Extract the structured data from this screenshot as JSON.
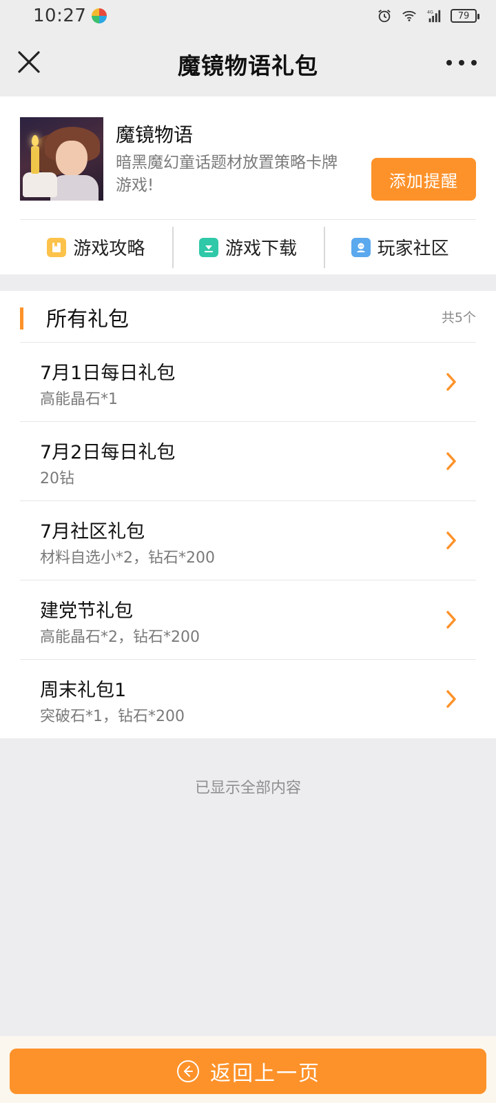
{
  "status_bar": {
    "time": "10:27",
    "battery": "79",
    "signal": "4G"
  },
  "header": {
    "title": "魔镜物语礼包"
  },
  "game": {
    "name": "魔镜物语",
    "description": "暗黑魔幻童话题材放置策略卡牌游戏!",
    "remind_button": "添加提醒",
    "links": [
      {
        "label": "游戏攻略",
        "icon": "guide-icon"
      },
      {
        "label": "游戏下载",
        "icon": "download-icon"
      },
      {
        "label": "玩家社区",
        "icon": "community-icon"
      }
    ]
  },
  "gift_section": {
    "title": "所有礼包",
    "count": "共5个",
    "items": [
      {
        "name": "7月1日每日礼包",
        "reward": "高能晶石*1"
      },
      {
        "name": "7月2日每日礼包",
        "reward": "20钻"
      },
      {
        "name": "7月社区礼包",
        "reward": "材料自选小*2，钻石*200"
      },
      {
        "name": "建党节礼包",
        "reward": "高能晶石*2，钻石*200"
      },
      {
        "name": "周末礼包1",
        "reward": "突破石*1，钻石*200"
      }
    ]
  },
  "end_note": "已显示全部内容",
  "bottom": {
    "back_button": "返回上一页"
  },
  "colors": {
    "accent": "#fd922a",
    "background": "#ededf0",
    "text_secondary": "#7a7a7a"
  }
}
